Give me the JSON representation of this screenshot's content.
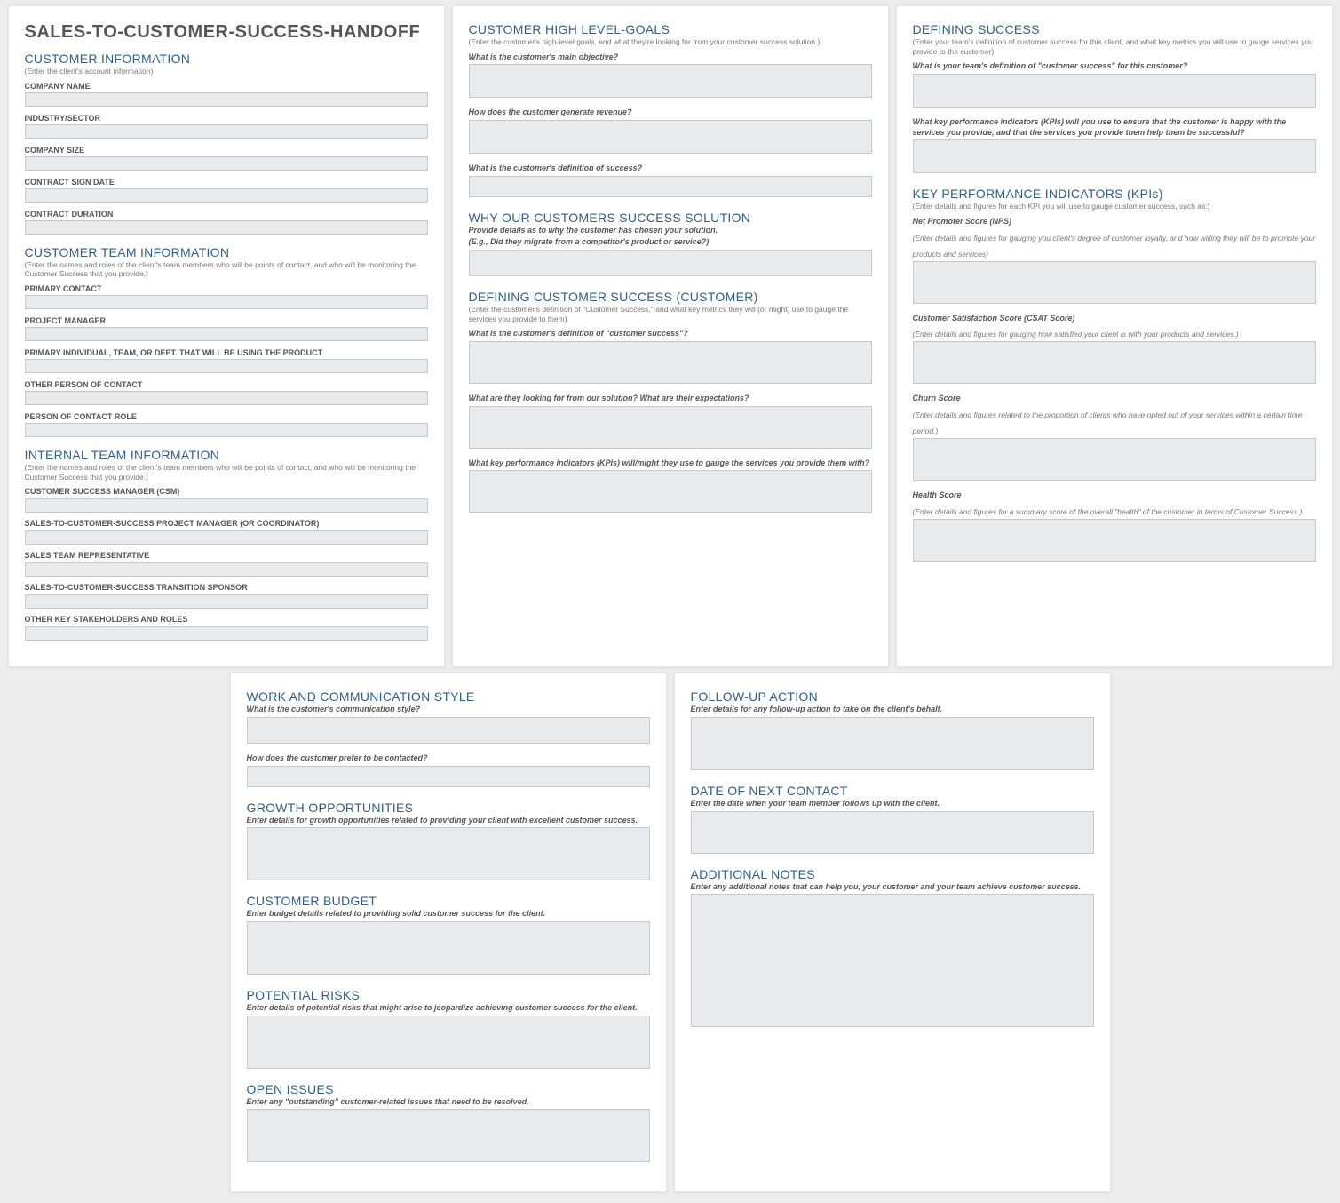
{
  "mainTitle": "SALES-TO-CUSTOMER-SUCCESS-HANDOFF",
  "card1": {
    "s1": {
      "title": "CUSTOMER INFORMATION",
      "sub": "(Enter the client's account information)",
      "f1": "COMPANY NAME",
      "f2": "INDUSTRY/SECTOR",
      "f3": "COMPANY SIZE",
      "f4": "CONTRACT SIGN DATE",
      "f5": "CONTRACT DURATION"
    },
    "s2": {
      "title": "CUSTOMER TEAM INFORMATION",
      "sub": "(Enter the names and roles of the client's team members who will be points of contact, and who will be monitoring the Customer Success that you provide.)",
      "f1": "PRIMARY CONTACT",
      "f2": "PROJECT MANAGER",
      "f3": "PRIMARY INDIVIDUAL, TEAM, OR DEPT. THAT WILL BE USING THE PRODUCT",
      "f4": "OTHER PERSON OF CONTACT",
      "f5": "PERSON OF CONTACT ROLE"
    },
    "s3": {
      "title": "INTERNAL TEAM INFORMATION",
      "sub": "(Enter the names and roles of the client's team members who will be points of contact, and who will be monitoring the Customer Success that you provide.)",
      "f1": "CUSTOMER SUCCESS MANAGER (CSM)",
      "f2": "SALES-TO-CUSTOMER-SUCCESS PROJECT MANAGER (OR COORDINATOR)",
      "f3": "SALES TEAM REPRESENTATIVE",
      "f4": "SALES-TO-CUSTOMER-SUCCESS TRANSITION SPONSOR",
      "f5": "OTHER KEY STAKEHOLDERS AND ROLES"
    }
  },
  "card2": {
    "s1": {
      "title": "CUSTOMER HIGH LEVEL-GOALS",
      "sub": "(Enter the customer's high-level goals, and what they're looking for from your customer success solution.)",
      "q1": "What is the customer's main objective?",
      "q2": "How does the customer generate revenue?",
      "q3": "What is the customer's definition of success?"
    },
    "s2": {
      "title": "WHY OUR CUSTOMERS SUCCESS SOLUTION",
      "q1a": "Provide details as to why the customer has chosen your solution.",
      "q1b": "(E.g., Did they migrate from a competitor's product or service?)"
    },
    "s3": {
      "title": "DEFINING CUSTOMER SUCCESS (CUSTOMER)",
      "sub": "(Enter the customer's definition of \"Customer Success,\" and what key metrics they will (or might) use to gauge the services you provide to them)",
      "q1": "What is the customer's definition of \"customer success\"?",
      "q2": "What are they looking for from our solution? What are their expectations?",
      "q3": "What key performance indicators (KPIs) will/might they use to gauge the services you provide them with?"
    }
  },
  "card3": {
    "s1": {
      "title": "DEFINING SUCCESS",
      "sub": "(Enter your team's definition of customer success for this client, and what key metrics you will use to gauge services you provide to the customer)",
      "q1": "What is your team's definition of \"customer success\" for this customer?",
      "q2": "What key performance indicators (KPIs) will you use to ensure that the customer is happy with the services you provide, and that the services you provide them help them be successful?"
    },
    "s2": {
      "title": "KEY PERFORMANCE INDICATORS (KPIs)",
      "sub": "(Enter details and figures for each KPI you will use to gauge customer success, such as:)",
      "k1t": "Net Promoter Score (NPS)",
      "k1s": "(Enter details and figures for gauging you client's degree of customer loyalty, and how willing they will be to promote your products and services)",
      "k2t": "Customer Satisfaction Score (CSAT Score)",
      "k2s": "(Enter details and figures for gauging how satisfied your client is with your products and services.)",
      "k3t": "Churn Score",
      "k3s": "(Enter details and figures related to the proportion of clients who have opted out of your services within a certain time period.)",
      "k4t": "Health Score",
      "k4s": "(Enter details and figures for a summary score of the overall \"health\" of the customer in terms of  Customer Success.)"
    }
  },
  "card4": {
    "s1": {
      "title": "WORK AND COMMUNICATION STYLE",
      "q1": "What is the customer's communication style?",
      "q2": "How does the customer prefer to be contacted?"
    },
    "s2": {
      "title": "GROWTH OPPORTUNITIES",
      "q1": "Enter details for growth opportunities related to providing your client with excellent customer success."
    },
    "s3": {
      "title": "CUSTOMER BUDGET",
      "q1": "Enter budget details related to providing solid customer success for the client."
    },
    "s4": {
      "title": "POTENTIAL RISKS",
      "q1": "Enter details of potential risks that might arise to jeopardize achieving customer success for the client."
    },
    "s5": {
      "title": "OPEN ISSUES",
      "q1": "Enter any \"outstanding\" customer-related issues that need to be resolved."
    }
  },
  "card5": {
    "s1": {
      "title": "FOLLOW-UP ACTION",
      "q1": "Enter details for any follow-up action to take on the client's behalf."
    },
    "s2": {
      "title": "DATE OF NEXT CONTACT",
      "q1": "Enter the date when your team member follows up with the client."
    },
    "s3": {
      "title": "ADDITIONAL NOTES",
      "q1": "Enter any additional notes that can help you, your customer and your team achieve customer success."
    }
  }
}
